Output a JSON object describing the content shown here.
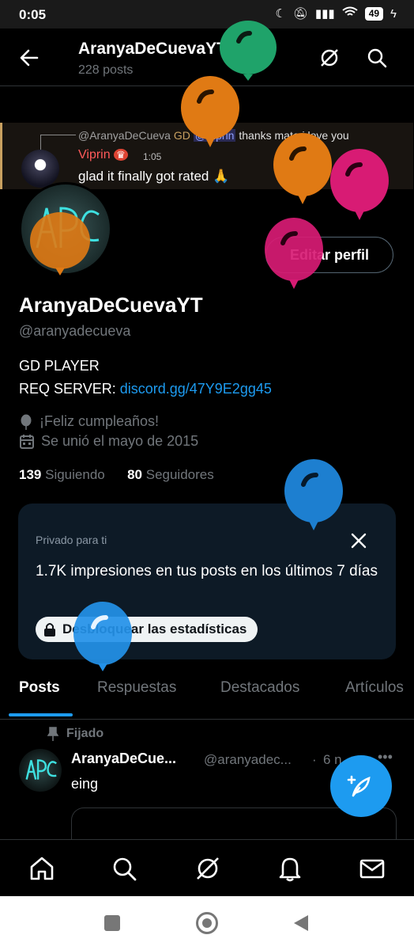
{
  "status": {
    "time": "0:05",
    "battery": "49"
  },
  "header": {
    "name": "AranyaDeCuevaYT",
    "posts": "228 posts"
  },
  "banner": {
    "reply_user": "@AranyaDeCueva",
    "reply_badge": "GD",
    "reply_mention": "@Viprin",
    "reply_text": "thanks mate i love you",
    "user": "Viprin",
    "time": "1:05",
    "message": "glad it finally got rated 🙏"
  },
  "profile": {
    "edit_label": "Editar perfil",
    "display_name": "AranyaDeCuevaYT",
    "handle": "@aranyadecueva",
    "bio_line1": "GD PLAYER",
    "bio_prefix": "REQ SERVER: ",
    "bio_link": "discord.gg/47Y9E2gg45",
    "birthday": "¡Feliz cumpleaños!",
    "joined": "Se unió el mayo de 2015",
    "following_count": "139",
    "following_label": "Siguiendo",
    "followers_count": "80",
    "followers_label": "Seguidores"
  },
  "stats_card": {
    "private_label": "Privado para ti",
    "title": "1.7K impresiones en tus posts en los últimos 7 días",
    "unlock_label": "Desbloquear las estadísticas"
  },
  "tabs": [
    "Posts",
    "Respuestas",
    "Destacados",
    "Artículos"
  ],
  "pinned_post": {
    "pinned_label": "Fijado",
    "name": "AranyaDeCue...",
    "handle": "@aranyadec...",
    "separator": "·",
    "time": "6 n",
    "text": "eing"
  },
  "colors": {
    "accent": "#1d9bf0",
    "card_bg": "#0d1a26",
    "balloon_green": "#1fa36a",
    "balloon_orange": "#e07a14",
    "balloon_pink": "#d81b74",
    "balloon_blue": "#1d7fd0"
  }
}
